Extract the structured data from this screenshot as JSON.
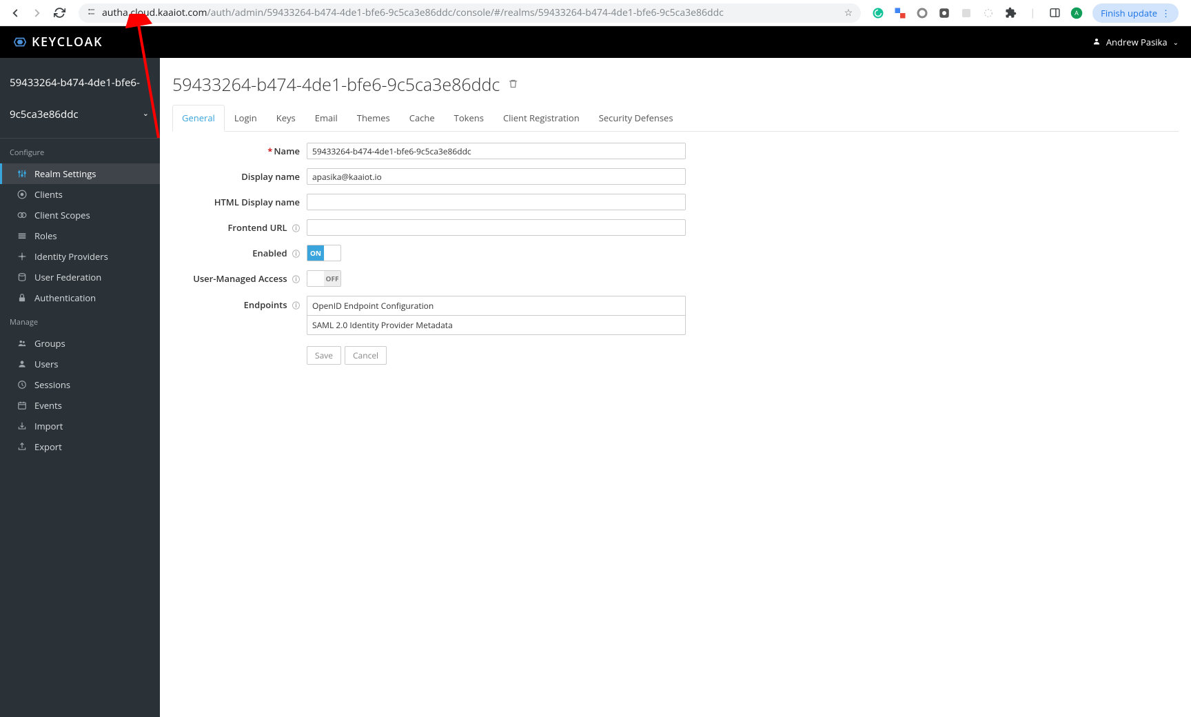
{
  "browser": {
    "url_domain": "autha.cloud.kaaiot.com",
    "url_path": "/auth/admin/59433264-b474-4de1-bfe6-9c5ca3e86ddc/console/#/realms/59433264-b474-4de1-bfe6-9c5ca3e86ddc",
    "finish_update": "Finish update"
  },
  "header": {
    "logo": "KEYCLOAK",
    "user_name": "Andrew Pasika"
  },
  "sidebar": {
    "realm_name_line1": "59433264-b474-4de1-bfe6-",
    "realm_name_line2": "9c5ca3e86ddc",
    "section_configure": "Configure",
    "section_manage": "Manage",
    "configure_items": [
      {
        "label": "Realm Settings"
      },
      {
        "label": "Clients"
      },
      {
        "label": "Client Scopes"
      },
      {
        "label": "Roles"
      },
      {
        "label": "Identity Providers"
      },
      {
        "label": "User Federation"
      },
      {
        "label": "Authentication"
      }
    ],
    "manage_items": [
      {
        "label": "Groups"
      },
      {
        "label": "Users"
      },
      {
        "label": "Sessions"
      },
      {
        "label": "Events"
      },
      {
        "label": "Import"
      },
      {
        "label": "Export"
      }
    ]
  },
  "page": {
    "title": "59433264-b474-4de1-bfe6-9c5ca3e86ddc",
    "tabs": [
      {
        "label": "General"
      },
      {
        "label": "Login"
      },
      {
        "label": "Keys"
      },
      {
        "label": "Email"
      },
      {
        "label": "Themes"
      },
      {
        "label": "Cache"
      },
      {
        "label": "Tokens"
      },
      {
        "label": "Client Registration"
      },
      {
        "label": "Security Defenses"
      }
    ],
    "form": {
      "name_label": "Name",
      "name_value": "59433264-b474-4de1-bfe6-9c5ca3e86ddc",
      "display_name_label": "Display name",
      "display_name_value": "apasika@kaaiot.io",
      "html_display_name_label": "HTML Display name",
      "html_display_name_value": "",
      "frontend_url_label": "Frontend URL",
      "frontend_url_value": "",
      "enabled_label": "Enabled",
      "enabled_on": "ON",
      "user_managed_access_label": "User-Managed Access",
      "user_managed_access_off": "OFF",
      "endpoints_label": "Endpoints",
      "endpoint_1": "OpenID Endpoint Configuration",
      "endpoint_2": "SAML 2.0 Identity Provider Metadata",
      "save": "Save",
      "cancel": "Cancel"
    }
  }
}
